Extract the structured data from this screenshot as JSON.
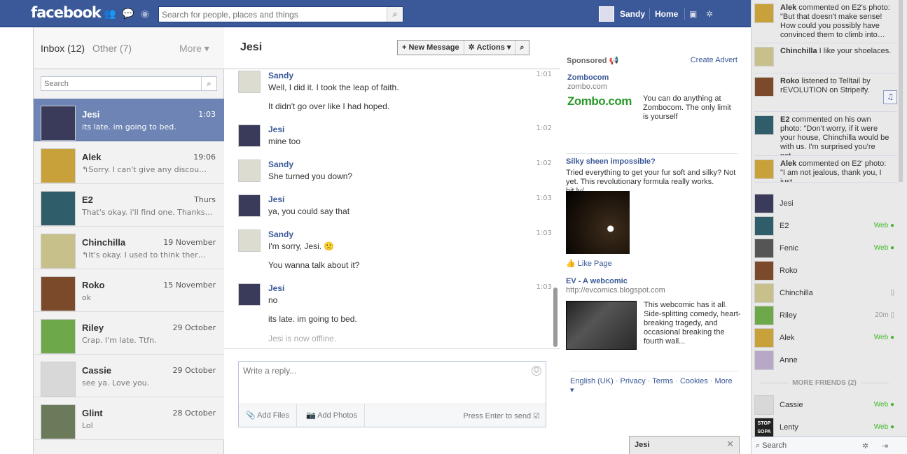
{
  "topbar": {
    "logo": "facebook",
    "search_placeholder": "Search for people, places and things",
    "user_name": "Sandy",
    "home": "Home"
  },
  "inbox": {
    "inbox_label": "Inbox (12)",
    "other_label": "Other (7)",
    "more_label": "More ▾",
    "search_placeholder": "Search",
    "threads": [
      {
        "name": "Jesi",
        "time": "1:03",
        "snippet": "its late. im going to bed.",
        "selected": true,
        "color": "#3a3a5a"
      },
      {
        "name": "Alek",
        "time": "19:06",
        "snippet": "↰Sorry. I can't give any discou…",
        "color": "#c9a13b"
      },
      {
        "name": "E2",
        "time": "Thurs",
        "snippet": "That's okay. i'll find one. Thanks…",
        "color": "#2f5d6a"
      },
      {
        "name": "Chinchilla",
        "time": "19 November",
        "snippet": "↰It's okay. I used to think ther…",
        "color": "#c8c08a"
      },
      {
        "name": "Roko",
        "time": "15 November",
        "snippet": "ok",
        "color": "#7a4a2a"
      },
      {
        "name": "Riley",
        "time": "29 October",
        "snippet": "Crap. I'm late. Ttfn.",
        "color": "#6da84a"
      },
      {
        "name": "Cassie",
        "time": "29 October",
        "snippet": "see ya. Love you.",
        "color": "#d8d8d8"
      },
      {
        "name": "Glint",
        "time": "28 October",
        "snippet": "Lol",
        "color": "#6a7a5a"
      }
    ]
  },
  "conversation": {
    "title": "Jesi",
    "new_message": "+ New Message",
    "actions": "✲ Actions ▾",
    "messages": [
      {
        "from": "Sandy",
        "time": "1:01",
        "lines": [
          "Well, I did it. I took the leap of faith.",
          "It didn't go over like I had hoped."
        ]
      },
      {
        "from": "Jesi",
        "time": "1:02",
        "lines": [
          "mine too"
        ]
      },
      {
        "from": "Sandy",
        "time": "1:02",
        "lines": [
          "She turned you down?"
        ]
      },
      {
        "from": "Jesi",
        "time": "1:03",
        "lines": [
          "ya, you could say that"
        ]
      },
      {
        "from": "Sandy",
        "time": "1:03",
        "lines": [
          "I'm sorry, Jesi. 🙁",
          "You wanna talk about it?"
        ]
      },
      {
        "from": "Jesi",
        "time": "1:03",
        "lines": [
          "no",
          "its late. im going to bed."
        ]
      }
    ],
    "offline_notice": "Jesi is now offline.",
    "reply_placeholder": "Write a reply...",
    "add_files": "Add Files",
    "add_photos": "Add Photos",
    "press_enter": "Press Enter to send"
  },
  "ads": {
    "sponsored": "Sponsored",
    "create_advert": "Create Advert",
    "items": [
      {
        "title": "Zombocom",
        "url": "zombo.com",
        "body": "You can do anything at Zombocom. The only limit is yourself",
        "logo": "Zombo.com"
      },
      {
        "title": "Silky sheen impossible?",
        "body": "Tried everything to get your fur soft and silky? Not yet. This revolutionary formula really works. bit.ly/...",
        "like": "Like Page"
      },
      {
        "title": "EV - A webcomic",
        "url": "http://evcomics.blogspot.com",
        "body": "This webcomic has it all. Side-splitting comedy, heart-breaking tragedy, and occasional breaking the fourth wall..."
      }
    ],
    "footer": [
      "English (UK)",
      "Privacy",
      "Terms",
      "Cookies",
      "More ▾"
    ]
  },
  "ticker": {
    "items": [
      {
        "name": "Alek",
        "text": " commented on E2's photo: \"But that doesn't make sense! How could you possibly have convinced them to climb into…",
        "color": "#c9a13b"
      },
      {
        "name": "Chinchilla",
        "text": " I like your shoelaces.",
        "color": "#c8c08a"
      },
      {
        "name": "Roko",
        "text": " listened to Telltail by rEVOLUTION on Stripeify.",
        "color": "#7a4a2a"
      },
      {
        "name": "E2",
        "text": " commented on his own photo: \"Don't worry, if it were your house, Chinchilla would be with us. I'm surprised you're not…",
        "color": "#2f5d6a"
      },
      {
        "name": "Alek",
        "text": " commented on E2' photo: \"I am not jealous, thank you, I just",
        "color": "#c9a13b"
      }
    ]
  },
  "chat": {
    "friends": [
      {
        "name": "Jesi",
        "status": "",
        "color": "#3a3a5a"
      },
      {
        "name": "E2",
        "status": "Web ●",
        "color": "#2f5d6a"
      },
      {
        "name": "Fenic",
        "status": "Web ●",
        "color": "#555"
      },
      {
        "name": "Roko",
        "status": "",
        "color": "#7a4a2a"
      },
      {
        "name": "Chinchilla",
        "status": "▯",
        "color": "#c8c08a"
      },
      {
        "name": "Riley",
        "status": "20m ▯",
        "color": "#6da84a"
      },
      {
        "name": "Alek",
        "status": "Web ●",
        "color": "#c9a13b"
      },
      {
        "name": "Anne",
        "status": "",
        "color": "#b8a8c8"
      }
    ],
    "more_friends": "MORE FRIENDS (2)",
    "more": [
      {
        "name": "Cassie",
        "status": "Web ●",
        "color": "#d8d8d8"
      },
      {
        "name": "Lenty",
        "status": "Web ●",
        "color": "#222",
        "badge": "STOP SOPA"
      }
    ],
    "search_label": "Search",
    "open_tab": "Jesi"
  }
}
